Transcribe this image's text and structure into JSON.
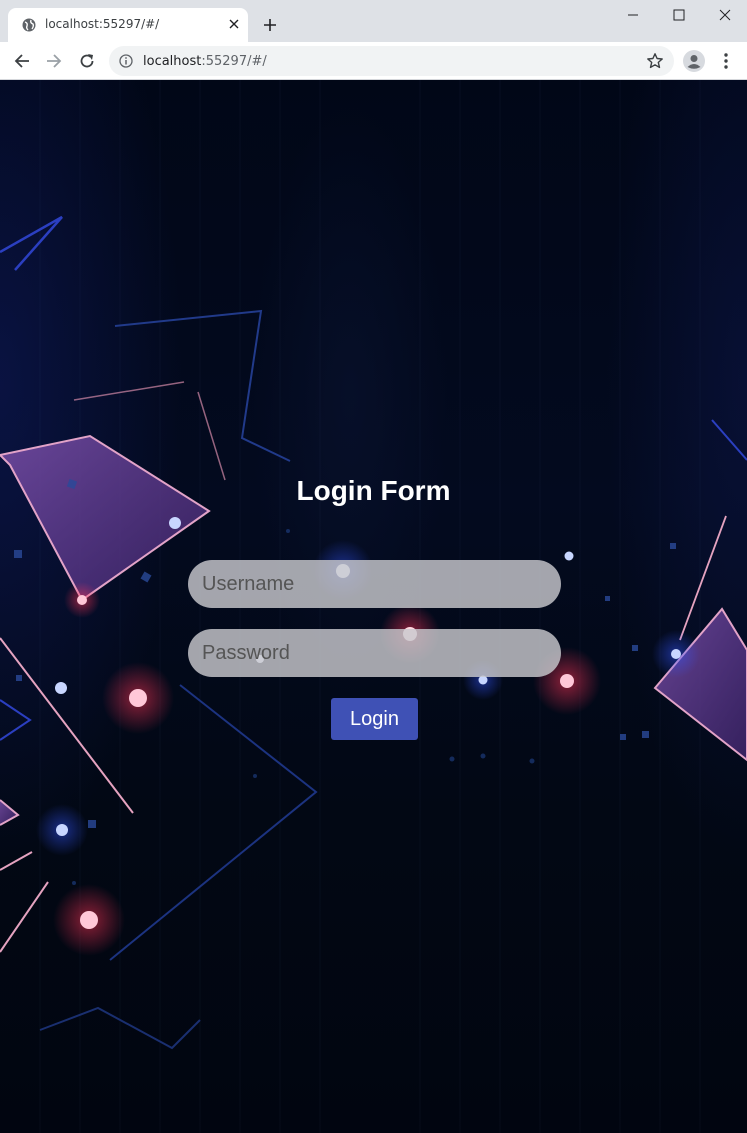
{
  "browser": {
    "tab_title": "localhost:55297/#/",
    "url_host": "localhost",
    "url_rest": ":55297/#/"
  },
  "login": {
    "title": "Login Form",
    "username_placeholder": "Username",
    "password_placeholder": "Password",
    "button_label": "Login"
  },
  "colors": {
    "button": "#3f51b5",
    "background": "#010717",
    "field": "#c8c8cd"
  }
}
